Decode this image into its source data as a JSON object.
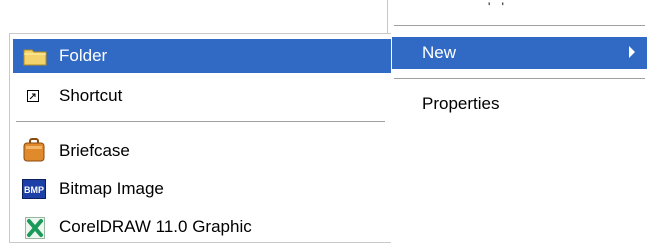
{
  "parent_menu": {
    "partial_item": "' '",
    "items": [
      {
        "label": "New",
        "mnemonic_index": 0,
        "has_submenu": true,
        "highlighted": true
      },
      {
        "label": "Properties",
        "mnemonic_index": 1,
        "has_submenu": false,
        "highlighted": false
      }
    ]
  },
  "submenu": {
    "items": [
      {
        "label": "Folder",
        "icon": "folder-icon",
        "highlighted": true
      },
      {
        "label": "Shortcut",
        "icon": "shortcut-icon",
        "highlighted": false
      },
      {
        "label": "Briefcase",
        "icon": "briefcase-icon",
        "highlighted": false
      },
      {
        "label": "Bitmap Image",
        "icon": "bitmap-icon",
        "highlighted": false
      },
      {
        "label": "CorelDRAW 11.0 Graphic",
        "icon": "coreldraw-icon",
        "highlighted": false
      }
    ]
  },
  "icon_text": {
    "bitmap": "BMP"
  },
  "colors": {
    "highlight": "#316ac5",
    "highlight_text": "#ffffff",
    "separator": "#a0a0a0"
  }
}
